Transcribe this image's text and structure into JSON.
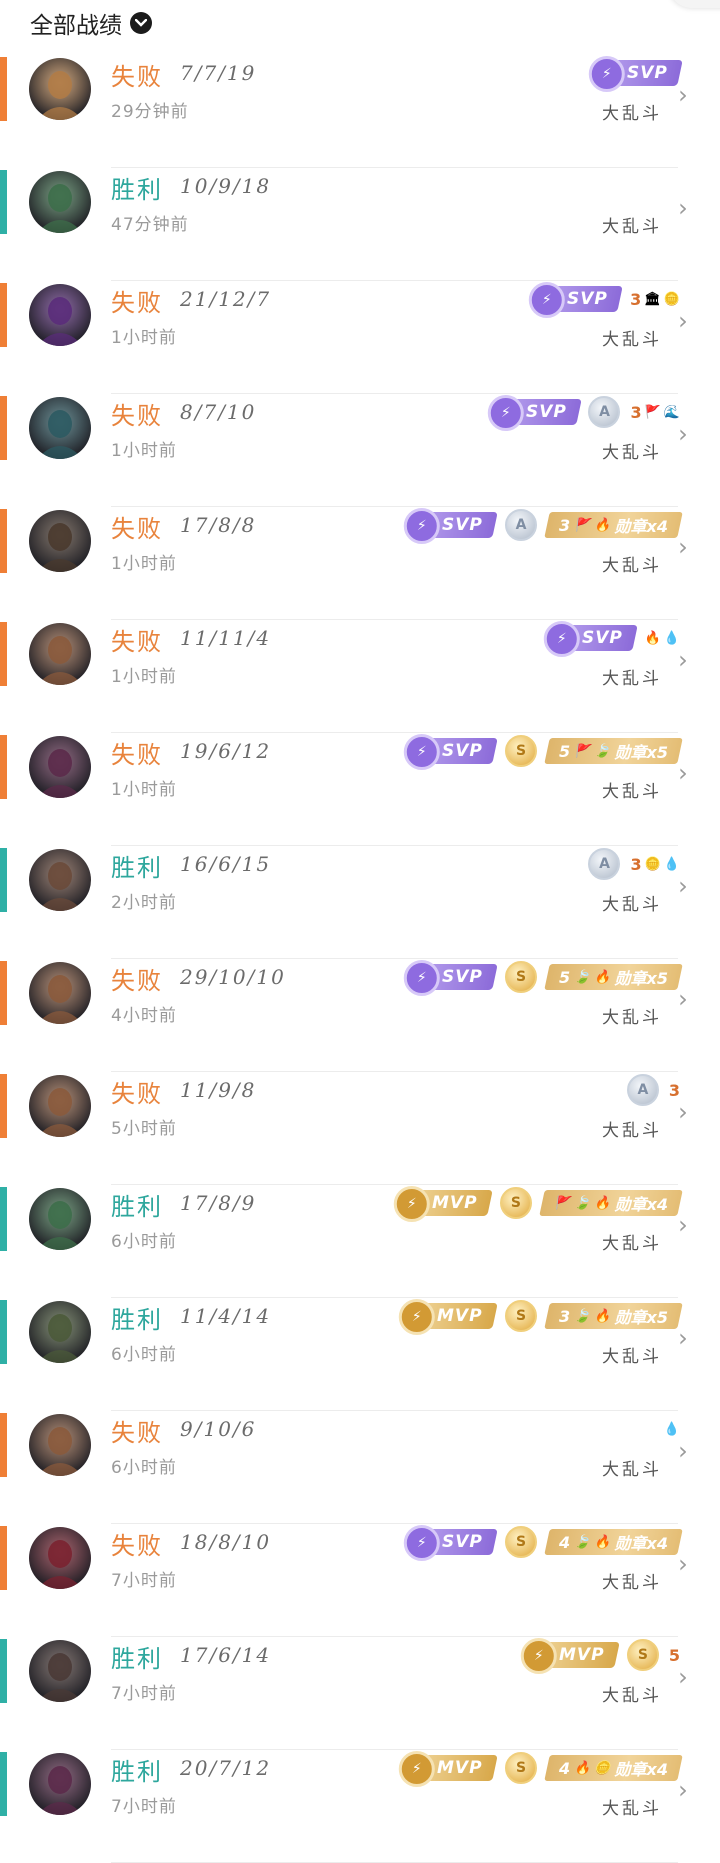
{
  "header": {
    "filter_label": "全部战绩"
  },
  "rows": [
    {
      "result": "失败",
      "kda": "7/7/19",
      "time": "29分钟前",
      "mode": "大乱斗",
      "outcome": "lose",
      "avatar_color": "#b07b46",
      "badges": [
        {
          "type": "svp",
          "label": "SVP"
        }
      ]
    },
    {
      "result": "胜利",
      "kda": "10/9/18",
      "time": "47分钟前",
      "mode": "大乱斗",
      "outcome": "win",
      "avatar_color": "#3d6e4a",
      "badges": []
    },
    {
      "result": "失败",
      "kda": "21/12/7",
      "time": "1小时前",
      "mode": "大乱斗",
      "outcome": "lose",
      "avatar_color": "#5a2c7a",
      "badges": [
        {
          "type": "svp",
          "label": "SVP"
        },
        {
          "type": "stats",
          "num": "3",
          "icons": [
            "🏛",
            "🪙"
          ]
        }
      ]
    },
    {
      "result": "失败",
      "kda": "8/7/10",
      "time": "1小时前",
      "mode": "大乱斗",
      "outcome": "lose",
      "avatar_color": "#2c5a62",
      "badges": [
        {
          "type": "svp",
          "label": "SVP"
        },
        {
          "type": "coin",
          "variant": "silver",
          "letter": "A"
        },
        {
          "type": "stats",
          "num": "3",
          "icons": [
            "🚩",
            "🌊"
          ]
        }
      ]
    },
    {
      "result": "失败",
      "kda": "17/8/8",
      "time": "1小时前",
      "mode": "大乱斗",
      "outcome": "lose",
      "avatar_color": "#4a3a2e",
      "badges": [
        {
          "type": "svp",
          "label": "SVP"
        },
        {
          "type": "coin",
          "variant": "silver",
          "letter": "A"
        },
        {
          "type": "medal",
          "num": "3",
          "icons": [
            "🚩",
            "🔥"
          ],
          "label": "勋章x4"
        }
      ]
    },
    {
      "result": "失败",
      "kda": "11/11/4",
      "time": "1小时前",
      "mode": "大乱斗",
      "outcome": "lose",
      "avatar_color": "#8a5a3c",
      "badges": [
        {
          "type": "svp",
          "label": "SVP"
        },
        {
          "type": "stats",
          "num": "",
          "icons": [
            "🔥",
            "💧"
          ]
        }
      ]
    },
    {
      "result": "失败",
      "kda": "19/6/12",
      "time": "1小时前",
      "mode": "大乱斗",
      "outcome": "lose",
      "avatar_color": "#5b2a4a",
      "badges": [
        {
          "type": "svp",
          "label": "SVP"
        },
        {
          "type": "coin",
          "variant": "gold",
          "letter": "S"
        },
        {
          "type": "medal",
          "num": "5",
          "icons": [
            "🚩",
            "🍃"
          ],
          "label": "勋章x5"
        }
      ]
    },
    {
      "result": "胜利",
      "kda": "16/6/15",
      "time": "2小时前",
      "mode": "大乱斗",
      "outcome": "win",
      "avatar_color": "#6a4a3a",
      "badges": [
        {
          "type": "coin",
          "variant": "silver",
          "letter": "A"
        },
        {
          "type": "stats",
          "num": "3",
          "icons": [
            "🪙",
            "💧"
          ]
        }
      ]
    },
    {
      "result": "失败",
      "kda": "29/10/10",
      "time": "4小时前",
      "mode": "大乱斗",
      "outcome": "lose",
      "avatar_color": "#8a5a3c",
      "badges": [
        {
          "type": "svp",
          "label": "SVP"
        },
        {
          "type": "coin",
          "variant": "gold",
          "letter": "S"
        },
        {
          "type": "medal",
          "num": "5",
          "icons": [
            "🍃",
            "🔥"
          ],
          "label": "勋章x5"
        }
      ]
    },
    {
      "result": "失败",
      "kda": "11/9/8",
      "time": "5小时前",
      "mode": "大乱斗",
      "outcome": "lose",
      "avatar_color": "#8a5a3c",
      "badges": [
        {
          "type": "coin",
          "variant": "silver",
          "letter": "A"
        },
        {
          "type": "stats",
          "num": "3",
          "icons": []
        }
      ]
    },
    {
      "result": "胜利",
      "kda": "17/8/9",
      "time": "6小时前",
      "mode": "大乱斗",
      "outcome": "win",
      "avatar_color": "#3d6e4a",
      "badges": [
        {
          "type": "mvp",
          "label": "MVP"
        },
        {
          "type": "coin",
          "variant": "gold",
          "letter": "S"
        },
        {
          "type": "medal",
          "num": "",
          "icons": [
            "🚩",
            "🍃",
            "🔥"
          ],
          "label": "勋章x4"
        }
      ]
    },
    {
      "result": "胜利",
      "kda": "11/4/14",
      "time": "6小时前",
      "mode": "大乱斗",
      "outcome": "win",
      "avatar_color": "#4b5a3a",
      "badges": [
        {
          "type": "mvp",
          "label": "MVP"
        },
        {
          "type": "coin",
          "variant": "gold",
          "letter": "S"
        },
        {
          "type": "medal",
          "num": "3",
          "icons": [
            "🍃",
            "🔥"
          ],
          "label": "勋章x5"
        }
      ]
    },
    {
      "result": "失败",
      "kda": "9/10/6",
      "time": "6小时前",
      "mode": "大乱斗",
      "outcome": "lose",
      "avatar_color": "#8a5a3c",
      "badges": [
        {
          "type": "stats",
          "num": "",
          "icons": [
            "💧"
          ]
        }
      ]
    },
    {
      "result": "失败",
      "kda": "18/8/10",
      "time": "7小时前",
      "mode": "大乱斗",
      "outcome": "lose",
      "avatar_color": "#7a2230",
      "badges": [
        {
          "type": "svp",
          "label": "SVP"
        },
        {
          "type": "coin",
          "variant": "gold",
          "letter": "S"
        },
        {
          "type": "medal",
          "num": "4",
          "icons": [
            "🍃",
            "🔥"
          ],
          "label": "勋章x4"
        }
      ]
    },
    {
      "result": "胜利",
      "kda": "17/6/14",
      "time": "7小时前",
      "mode": "大乱斗",
      "outcome": "win",
      "avatar_color": "#4a3a36",
      "badges": [
        {
          "type": "mvp",
          "label": "MVP"
        },
        {
          "type": "coin",
          "variant": "gold",
          "letter": "S"
        },
        {
          "type": "stats",
          "num": "5",
          "icons": []
        }
      ]
    },
    {
      "result": "胜利",
      "kda": "20/7/12",
      "time": "7小时前",
      "mode": "大乱斗",
      "outcome": "win",
      "avatar_color": "#5b2a4a",
      "badges": [
        {
          "type": "mvp",
          "label": "MVP"
        },
        {
          "type": "coin",
          "variant": "gold",
          "letter": "S"
        },
        {
          "type": "medal",
          "num": "4",
          "icons": [
            "🔥",
            "🪙"
          ],
          "label": "勋章x4"
        }
      ]
    }
  ]
}
